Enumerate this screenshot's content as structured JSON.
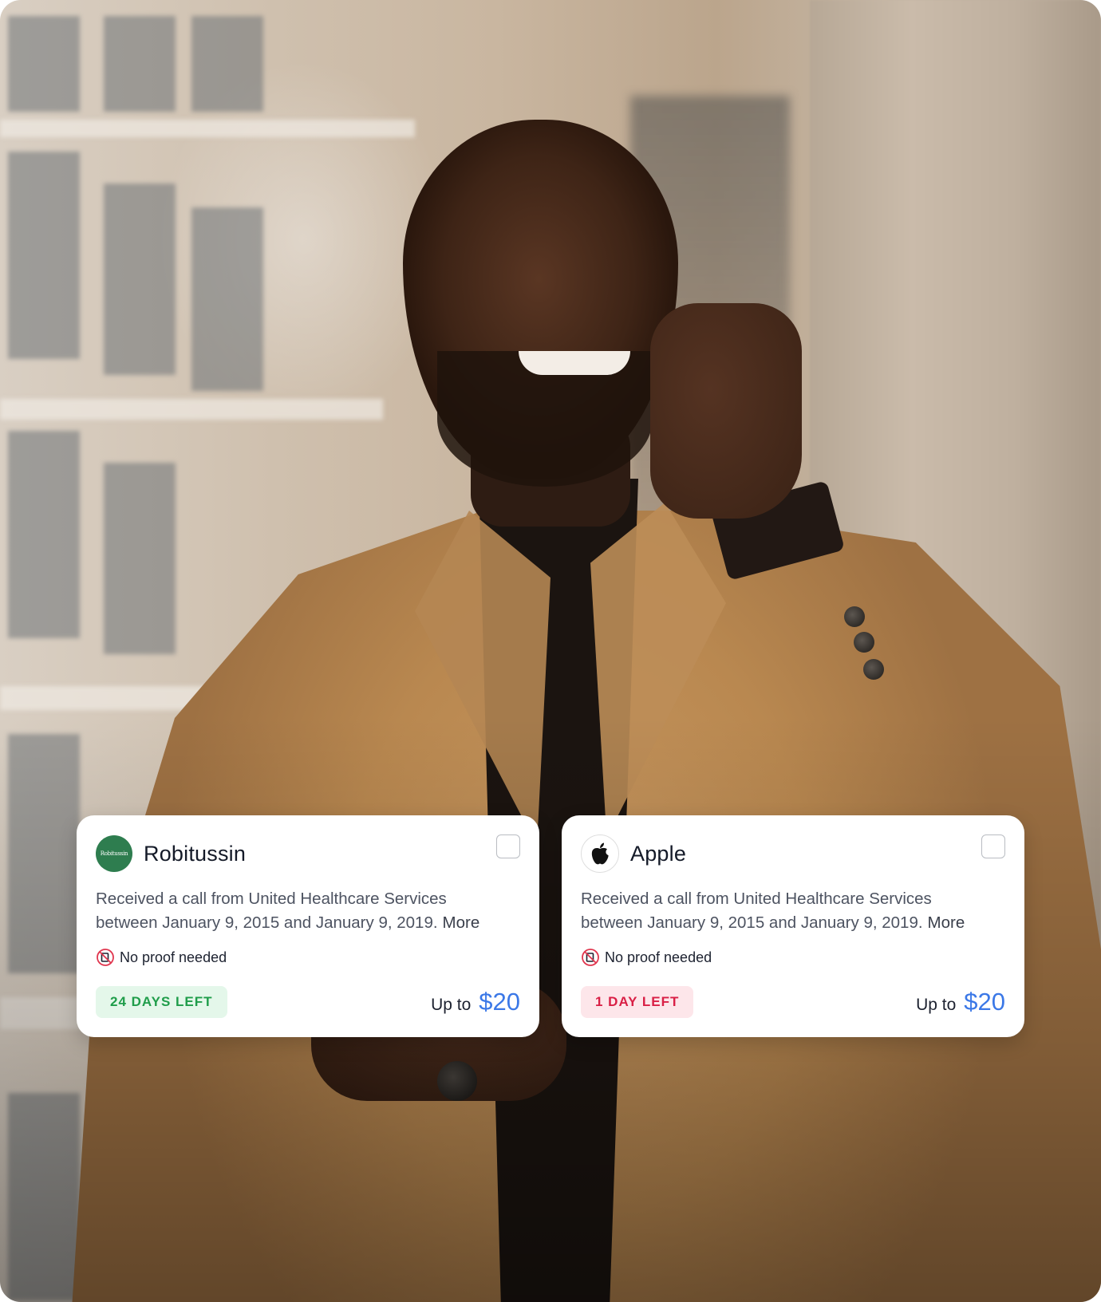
{
  "cards": [
    {
      "company": "Robitussin",
      "logo_text": "Robitussin",
      "description_line1": "Received a call from United Healthcare Services",
      "description_line2": "between January 9, 2015 and January 9, 2019.",
      "more_label": "More",
      "proof_label": "No proof needed",
      "deadline_label": "24 DAYS LEFT",
      "deadline_color": "#1f9d4a",
      "payout_prefix": "Up to",
      "payout_amount": "$20"
    },
    {
      "company": "Apple",
      "logo_icon": "apple-logo-icon",
      "description_line1": "Received a call from United Healthcare Services",
      "description_line2": "between January 9, 2015 and January 9, 2019.",
      "more_label": "More",
      "proof_label": "No proof needed",
      "deadline_label": "1 DAY LEFT",
      "deadline_color": "#d91f45",
      "payout_prefix": "Up to",
      "payout_amount": "$20"
    }
  ],
  "colors": {
    "accent_amount": "#3b78e7",
    "badge_green_bg": "#e4f7ea",
    "badge_red_bg": "#fde6ea",
    "robitussin_logo": "#2e7d4f"
  },
  "icons": [
    "no-proof-icon",
    "checkbox-icon",
    "apple-logo-icon",
    "robitussin-logo"
  ]
}
